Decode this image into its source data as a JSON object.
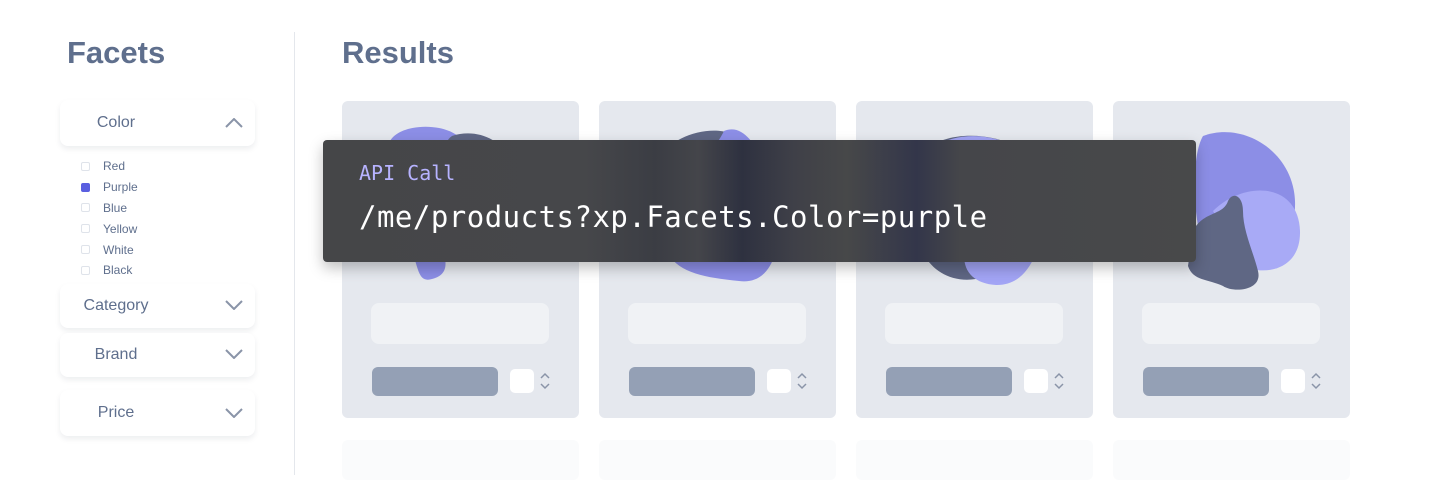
{
  "facets_heading": "Facets",
  "results_heading": "Results",
  "facets": [
    {
      "label": "Color",
      "expanded": true
    },
    {
      "label": "Category",
      "expanded": false
    },
    {
      "label": "Brand",
      "expanded": false
    },
    {
      "label": "Price",
      "expanded": false
    }
  ],
  "color_options": [
    {
      "label": "Red",
      "checked": false
    },
    {
      "label": "Purple",
      "checked": true
    },
    {
      "label": "Blue",
      "checked": false
    },
    {
      "label": "Yellow",
      "checked": false
    },
    {
      "label": "White",
      "checked": false
    },
    {
      "label": "Black",
      "checked": false
    }
  ],
  "api_call": {
    "label": "API Call",
    "url": "/me/products?xp.Facets.Color=purple"
  },
  "colors": {
    "heading": "#5f6f8d",
    "card_bg": "#e5e8ee",
    "button": "#94a0b5",
    "accent": "#5a5fe0",
    "blob_purple": "#8c8ee6",
    "blob_dark": "#5f6784"
  }
}
